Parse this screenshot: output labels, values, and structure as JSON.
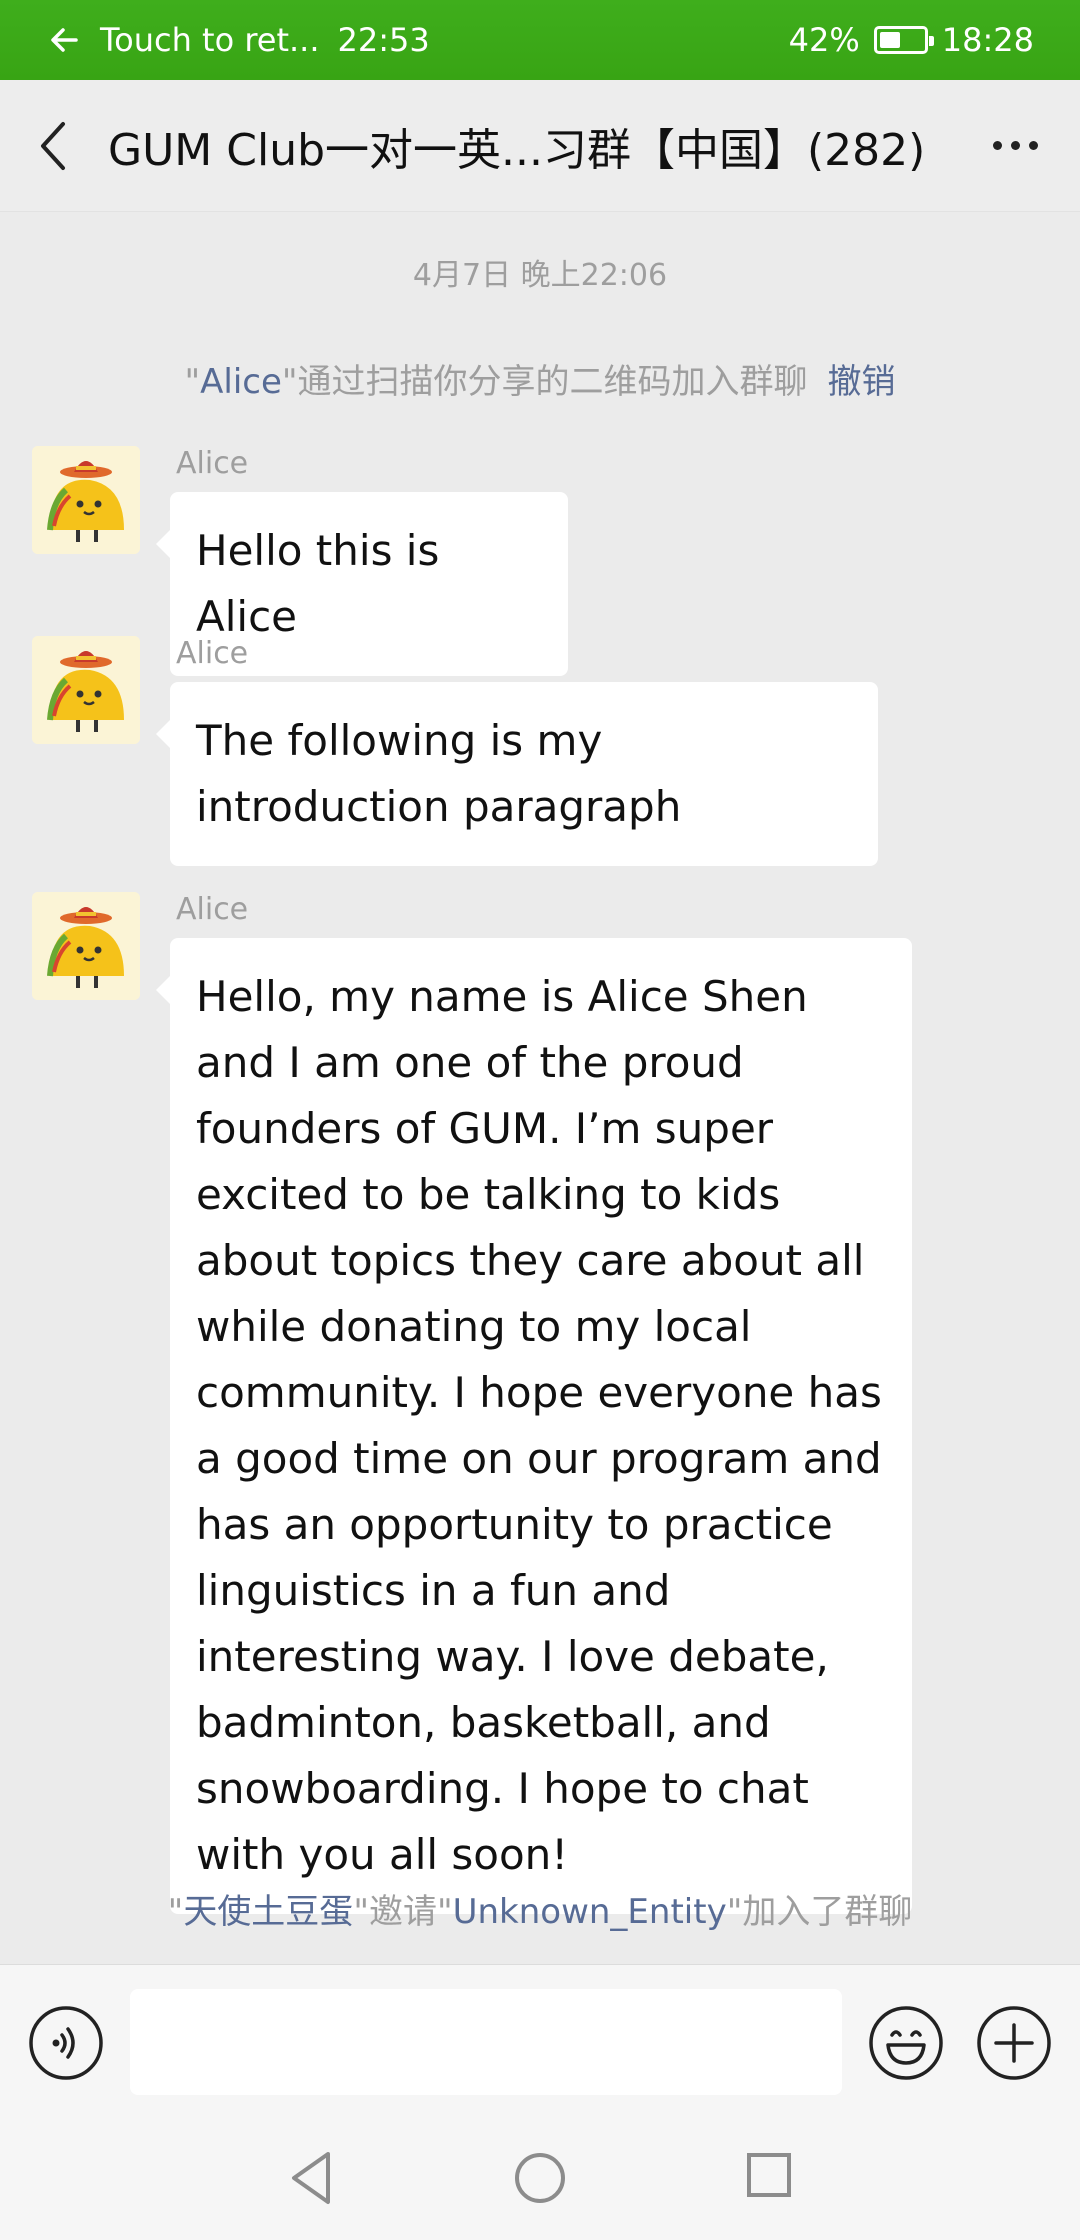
{
  "status_bar": {
    "return_text": "Touch to ret...",
    "call_time": "22:53",
    "battery": "42%",
    "battery_level": 0.42,
    "clock": "18:28"
  },
  "header": {
    "title": "GUM Club一对一英...习群【中国】(282)"
  },
  "chat": {
    "timestamp": "4月7日 晚上22:06",
    "join_notice": {
      "quote_open": "\"",
      "name": "Alice",
      "text": "\"通过扫描你分享的二维码加入群聊",
      "action": "撤销"
    },
    "messages": [
      {
        "sender": "Alice",
        "text": "Hello this is Alice"
      },
      {
        "sender": "Alice",
        "text": "The following is my introduction paragraph"
      },
      {
        "sender": "Alice",
        "text": "Hello, my name is Alice Shen and I am one of the proud founders of GUM. I’m super excited to be talking to kids about topics they care about  all while donating to my local  community. I hope everyone has a good time on our program and has an opportunity to practice linguistics in a fun and interesting way. I love debate, badminton, basketball, and snowboarding. I hope to chat with you all soon!"
      }
    ],
    "invite_notice": {
      "q1": "\"",
      "inviter": "天使土豆蛋",
      "mid": "\"邀请\"",
      "invitee": "Unknown_Entity",
      "end": "\"加入了群聊"
    }
  },
  "input": {
    "value": "",
    "placeholder": ""
  },
  "icons": {
    "status_back": "arrow-left-icon",
    "back": "chevron-left-icon",
    "more": "more-dots-icon",
    "voice": "voice-icon",
    "emoji": "emoji-icon",
    "plus": "plus-icon",
    "nav_back": "triangle-back-icon",
    "nav_home": "circle-home-icon",
    "nav_recent": "square-recent-icon"
  },
  "colors": {
    "status_bar": "#3aa817",
    "link": "#576b95",
    "system_text": "#9e9e9e",
    "chat_bg": "#ebebeb"
  }
}
